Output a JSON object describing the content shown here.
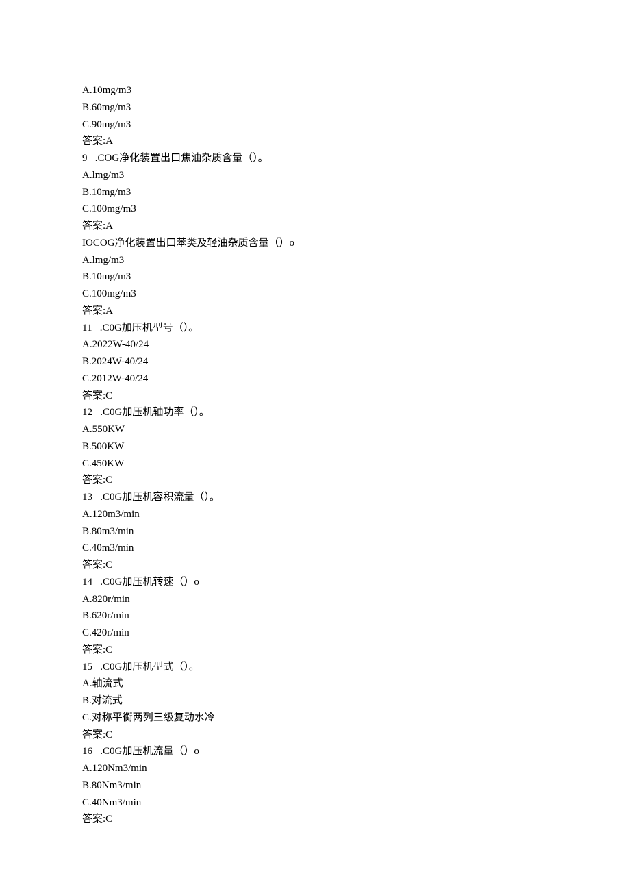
{
  "lines": [
    "A.10mg/m3",
    "B.60mg/m3",
    "C.90mg/m3",
    "答案:A",
    "9   .COG净化装置出口焦油杂质含量（）。",
    "A.lmg/m3",
    "B.10mg/m3",
    "C.100mg/m3",
    "答案:A",
    "IOCOG净化装置出口苯类及轻油杂质含量（）o",
    "A.lmg/m3",
    "B.10mg/m3",
    "C.100mg/m3",
    "答案:A",
    "11   .C0G加压机型号（）。",
    "A.2022W-40/24",
    "B.2024W-40/24",
    "C.2012W-40/24",
    "答案:C",
    "12   .C0G加压机轴功率（）。",
    "A.550KW",
    "B.500KW",
    "C.450KW",
    "答案:C",
    "13   .C0G加压机容积流量（）。",
    "A.120m3/min",
    "B.80m3/min",
    "C.40m3/min",
    "答案:C",
    "14   .C0G加压机转速（）o",
    "A.820r/min",
    "B.620r/min",
    "C.420r/min",
    "答案:C",
    "15   .C0G加压机型式（）。",
    "A.轴流式",
    "B.对流式",
    "C.对称平衡两列三级复动水冷",
    "答案:C",
    "16   .C0G加压机流量（）o",
    "A.120Nm3/min",
    "B.80Nm3/min",
    "C.40Nm3/min",
    "答案:C"
  ]
}
